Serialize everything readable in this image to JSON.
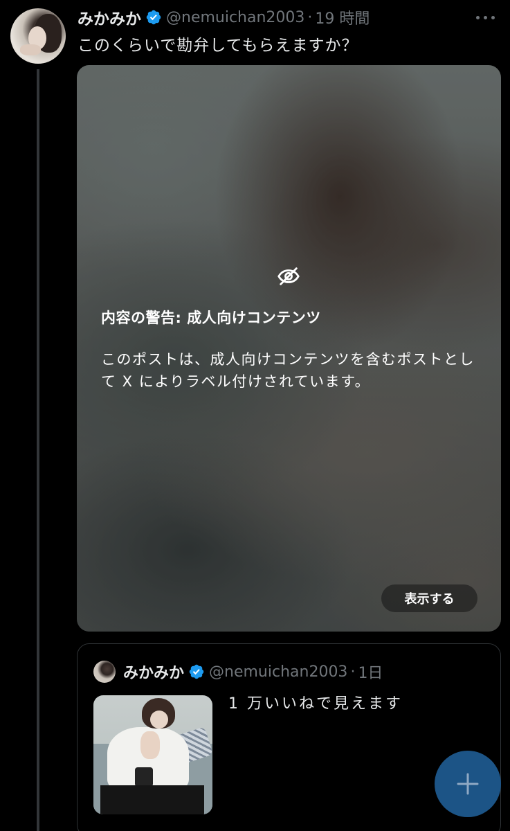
{
  "tweet": {
    "author": {
      "display_name": "みかみか",
      "handle": "@nemuichan2003",
      "verified_icon": "verified-badge-icon"
    },
    "separator": "·",
    "time": "19 時間",
    "text": "このくらいで勘弁してもらえますか？",
    "more_icon": "more-horizontal-icon"
  },
  "sensitive_media": {
    "icon": "eye-off-icon",
    "title": "内容の警告: 成人向けコンテンツ",
    "body": "このポストは、成人向けコンテンツを含むポストとして X によりラベル付けされています。",
    "show_label": "表示する"
  },
  "quoted_tweet": {
    "author": {
      "display_name": "みかみか",
      "handle": "@nemuichan2003",
      "verified_icon": "verified-badge-icon"
    },
    "separator": "·",
    "time": "1日",
    "text": "1 万いいねで見えます"
  },
  "compose_button": {
    "icon": "plus-icon"
  },
  "colors": {
    "background": "#000000",
    "text": "#e7e9ea",
    "secondary_text": "#71767b",
    "verified_blue": "#1d9bf0",
    "border": "#2f3336",
    "fab": "#1c5486"
  }
}
